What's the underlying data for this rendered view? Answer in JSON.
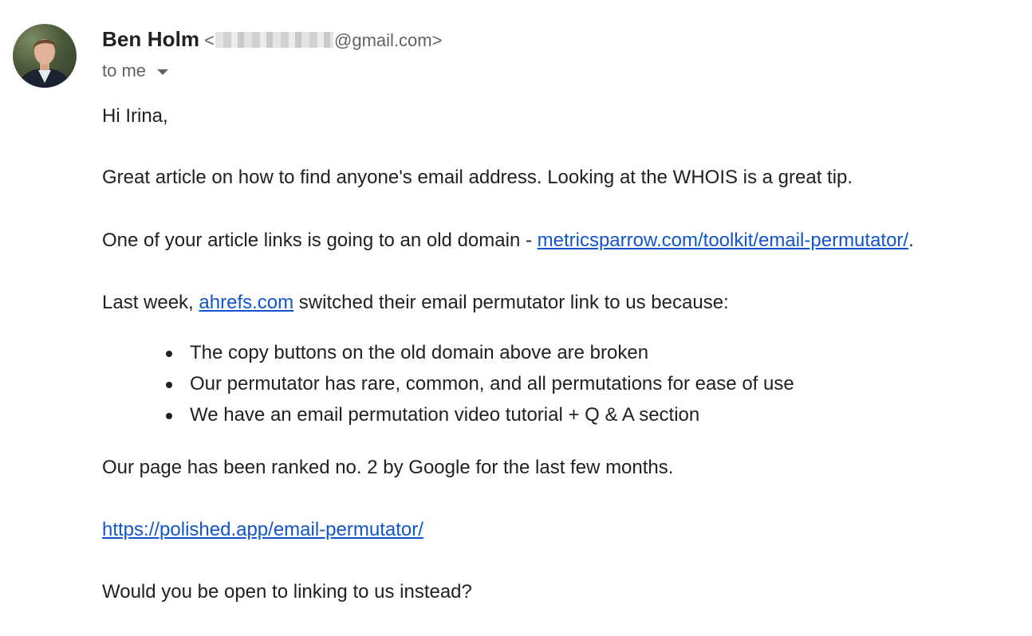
{
  "sender": {
    "name": "Ben Holm",
    "email_open": "<",
    "email_domain": "@gmail.com>"
  },
  "recipient": {
    "label": "to me"
  },
  "message": {
    "greeting": "Hi Irina,",
    "p1": "Great article on how to find anyone's email address. Looking at the WHOIS is a great tip.",
    "p2_before": "One of your article links is going to an old domain - ",
    "p2_link": "metricsparrow.com/toolkit/email-permutator/",
    "p2_after": ".",
    "p3_before": "Last week, ",
    "p3_link": "ahrefs.com",
    "p3_after": " switched their email permutator link to us because:",
    "bullets": [
      "The copy buttons on the old domain above are broken",
      "Our permutator has rare, common, and all permutations for ease of use",
      "We have an email permutation video tutorial + Q & A section"
    ],
    "p4": "Our page has been ranked no. 2 by Google for the last few months.",
    "p5_link": "https://polished.app/email-permutator/",
    "p6": "Would you be open to linking to us instead?"
  }
}
